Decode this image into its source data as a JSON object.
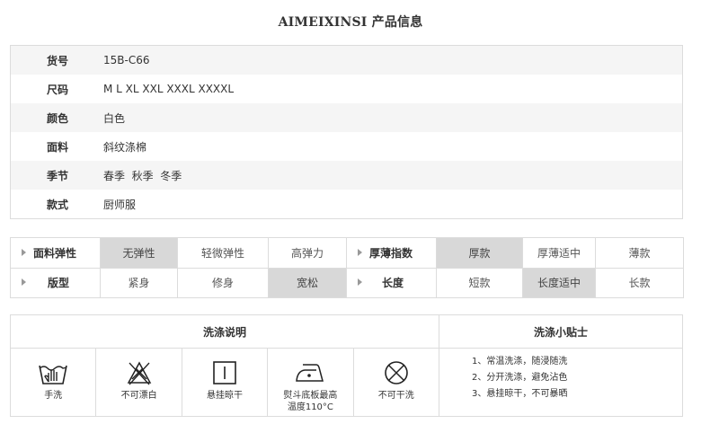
{
  "header": {
    "brand": "AIMEIXINSI",
    "suffix": " 产品信息"
  },
  "info_rows": [
    {
      "key": "货号",
      "value": "15B-C66"
    },
    {
      "key": "尺码",
      "value": "M L XL XXL XXXL XXXXL"
    },
    {
      "key": "颜色",
      "value": "白色"
    },
    {
      "key": "面料",
      "value": "斜纹涤棉"
    },
    {
      "key": "季节",
      "value": "春季  秋季  冬季"
    },
    {
      "key": "款式",
      "value": "厨师服"
    }
  ],
  "attributes": {
    "elasticity": {
      "label": "面料弹性",
      "options": [
        "无弹性",
        "轻微弹性",
        "高弹力"
      ],
      "selected": "无弹性"
    },
    "thickness": {
      "label": "厚薄指数",
      "options": [
        "厚款",
        "厚薄适中",
        "薄款"
      ],
      "selected": "厚款"
    },
    "fit": {
      "label": "版型",
      "options": [
        "紧身",
        "修身",
        "宽松"
      ],
      "selected": "宽松"
    },
    "length": {
      "label": "长度",
      "options": [
        "短款",
        "长度适中",
        "长款"
      ],
      "selected": "长度适中"
    }
  },
  "care": {
    "title": "洗涤说明",
    "tips_title": "洗涤小贴士",
    "icons": [
      {
        "icon": "hand-wash-icon",
        "caption": "手洗"
      },
      {
        "icon": "no-bleach-icon",
        "caption": "不可漂白"
      },
      {
        "icon": "hang-dry-icon",
        "caption": "悬挂晾干"
      },
      {
        "icon": "iron-icon",
        "caption": "熨斗底板最高温度110°C"
      },
      {
        "icon": "no-dry-clean-icon",
        "caption": "不可干洗"
      }
    ],
    "tips": [
      "1、常温洗涤，随浸随洗",
      "2、分开洗涤，避免沾色",
      "3、悬挂晾干，不可暴晒"
    ]
  }
}
